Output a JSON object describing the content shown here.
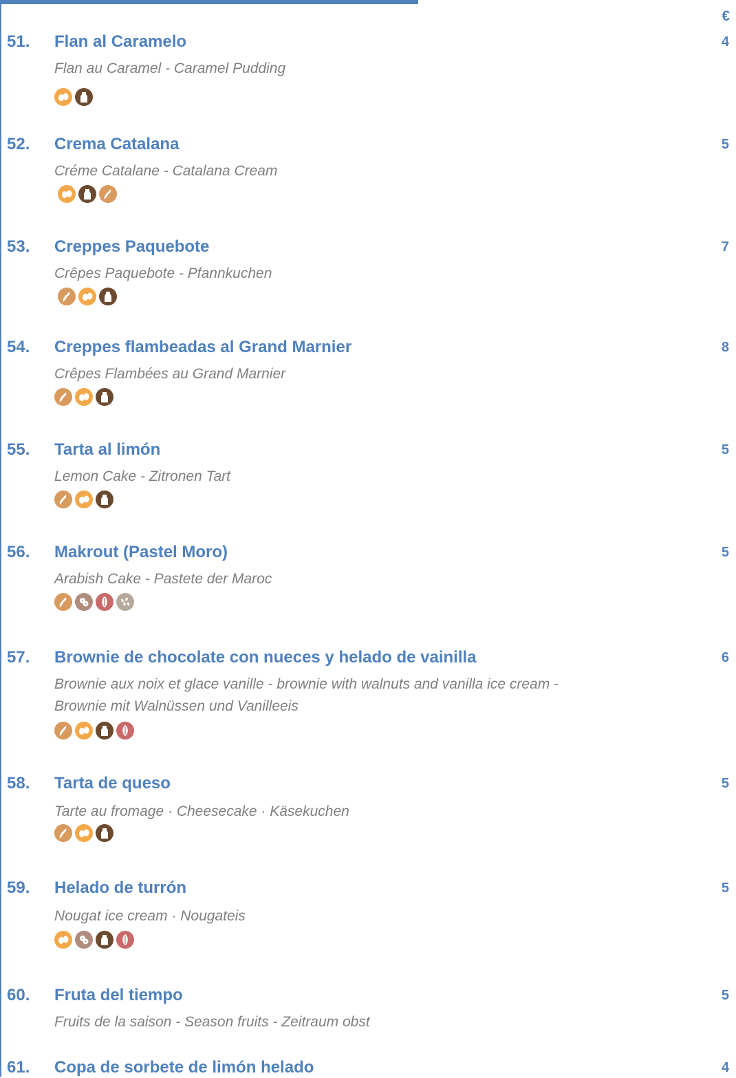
{
  "header": {
    "currency": "€"
  },
  "items": [
    {
      "number": "51.",
      "name": "Flan al Caramelo",
      "price": "4",
      "desc": [
        "Flan au Caramel - Caramel Pudding"
      ],
      "allergens": [
        "egg-icon",
        "milk-icon"
      ]
    },
    {
      "number": "52.",
      "name": "Crema Catalana",
      "price": "5",
      "desc": [
        "Créme Catalane - Catalana Cream"
      ],
      "allergens": [
        "egg-icon",
        "milk-icon",
        "gluten-icon"
      ]
    },
    {
      "number": "53.",
      "name": "Creppes Paquebote",
      "price": "7",
      "desc": [
        "Crêpes Paquebote - Pfannkuchen"
      ],
      "allergens": [
        "gluten-icon",
        "egg-icon",
        "milk-icon"
      ]
    },
    {
      "number": "54.",
      "name": "Creppes flambeadas al Grand Marnier",
      "price": "8",
      "desc": [
        "Crêpes Flambées au Grand Marnier"
      ],
      "allergens": [
        "gluten-icon",
        "egg-icon",
        "milk-icon"
      ]
    },
    {
      "number": "55.",
      "name": "Tarta al limón",
      "price": "5",
      "desc": [
        "Lemon Cake - Zitronen Tart"
      ],
      "allergens": [
        "gluten-icon",
        "egg-icon",
        "milk-icon"
      ]
    },
    {
      "number": "56.",
      "name": "Makrout (Pastel Moro)",
      "price": "5",
      "desc": [
        "Arabish Cake - Pastete der Maroc"
      ],
      "allergens": [
        "gluten-icon",
        "peanut-icon",
        "nuts-icon",
        "sesame-icon"
      ]
    },
    {
      "number": "57.",
      "name": "Brownie de chocolate con nueces y helado de vainilla",
      "price": "6",
      "desc": [
        "Brownie aux noix et glace vanille - brownie with walnuts and vanilla ice cream -",
        "Brownie mit Walnüssen und Vanilleeis"
      ],
      "allergens": [
        "gluten-icon",
        "egg-icon",
        "milk-icon",
        "nuts-icon"
      ]
    },
    {
      "number": "58.",
      "name": "Tarta de queso",
      "price": "5",
      "desc": [
        "Tarte au fromage · Cheesecake · Käsekuchen"
      ],
      "allergens": [
        "gluten-icon",
        "egg-icon",
        "milk-icon"
      ]
    },
    {
      "number": "59.",
      "name": "Helado de turrón",
      "price": "5",
      "desc": [
        "Nougat ice cream ·  Nougateis"
      ],
      "allergens": [
        "egg-icon",
        "peanut-icon",
        "milk-icon",
        "nuts-icon"
      ]
    },
    {
      "number": "60.",
      "name": "Fruta del tiempo",
      "price": "5",
      "desc": [
        "Fruits de la saison - Season fruits - Zeitraum obst"
      ],
      "allergens": []
    },
    {
      "number": "61.",
      "name": "Copa de sorbete de limón helado",
      "price": "4",
      "desc": [],
      "allergens": []
    }
  ],
  "allergen_colors": {
    "gluten-icon": "#d99a5e",
    "egg-icon": "#f3a94b",
    "milk-icon": "#6b4a2f",
    "peanut-icon": "#b08c7c",
    "nuts-icon": "#c96a6a",
    "sesame-icon": "#b4a99a"
  }
}
